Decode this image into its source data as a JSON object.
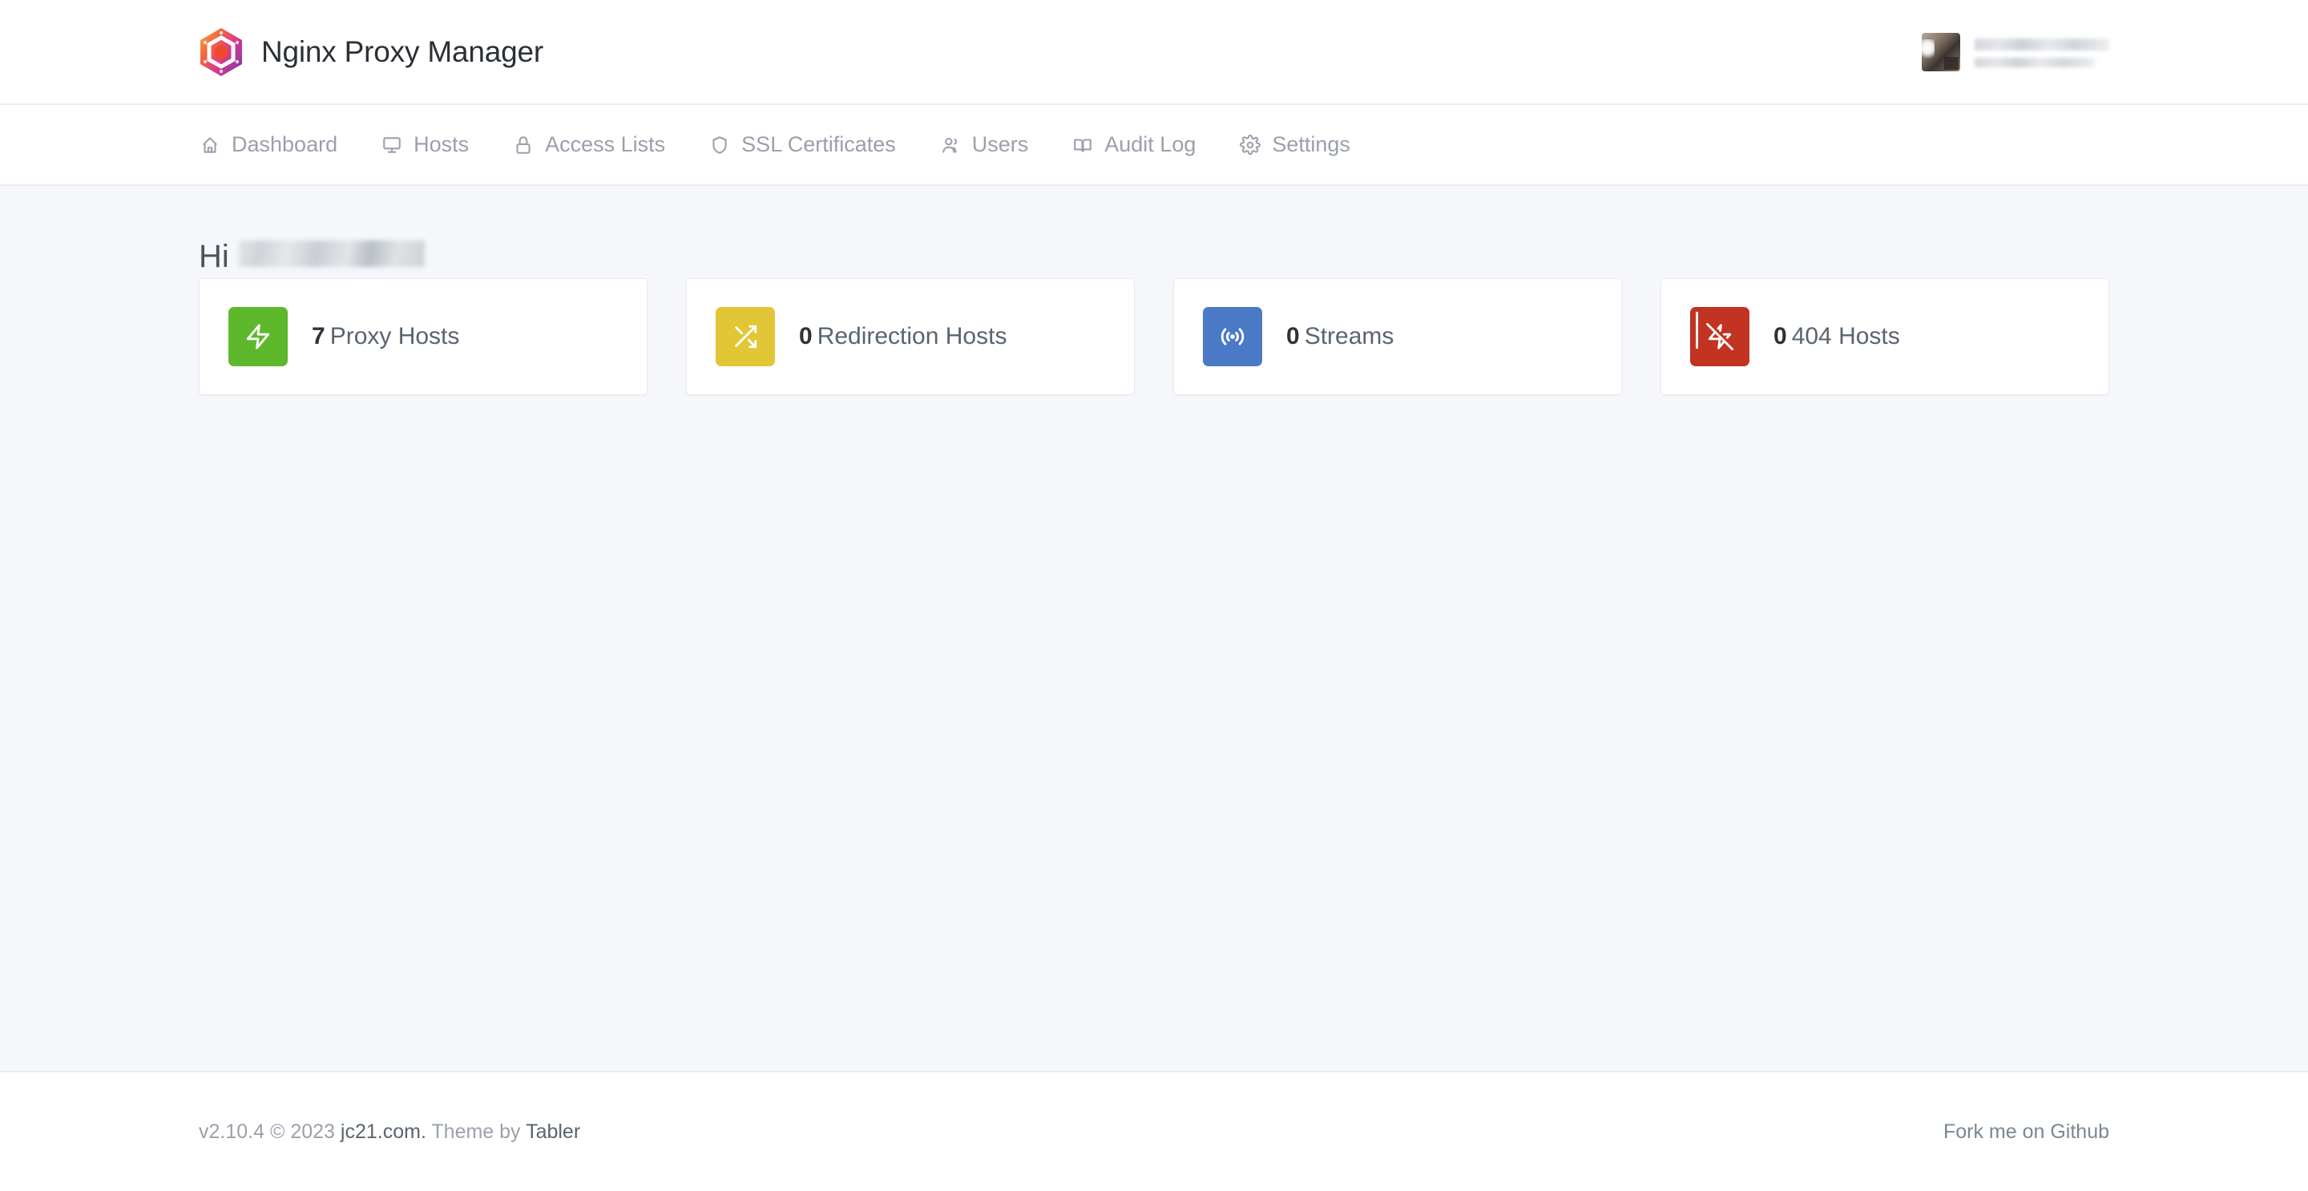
{
  "header": {
    "brand_title": "Nginx Proxy Manager",
    "logo_icon": "npm-hexagon-logo",
    "user": {
      "avatar_icon": "user-avatar",
      "name_redacted": "",
      "role_redacted": ""
    }
  },
  "nav": {
    "items": [
      {
        "label": "Dashboard",
        "icon": "home-icon"
      },
      {
        "label": "Hosts",
        "icon": "monitor-icon"
      },
      {
        "label": "Access Lists",
        "icon": "lock-icon"
      },
      {
        "label": "SSL Certificates",
        "icon": "shield-icon"
      },
      {
        "label": "Users",
        "icon": "users-icon"
      },
      {
        "label": "Audit Log",
        "icon": "book-open-icon"
      },
      {
        "label": "Settings",
        "icon": "gear-icon"
      }
    ]
  },
  "main": {
    "greeting_prefix": "Hi",
    "greeting_name_redacted": "",
    "cards": [
      {
        "count": "7",
        "label": "Proxy Hosts",
        "icon": "zap-icon",
        "color": "#5eb82c"
      },
      {
        "count": "0",
        "label": "Redirection Hosts",
        "icon": "shuffle-icon",
        "color": "#e2c636"
      },
      {
        "count": "0",
        "label": "Streams",
        "icon": "broadcast-icon",
        "color": "#4a7ac5"
      },
      {
        "count": "0",
        "label": "404 Hosts",
        "icon": "zap-off-icon",
        "color": "#c23321"
      }
    ]
  },
  "footer": {
    "version": "v2.10.4",
    "copyright": "© 2023",
    "site_link": "jc21.com.",
    "theme_prefix": "Theme by",
    "theme_link": "Tabler",
    "github_link": "Fork me on Github"
  }
}
